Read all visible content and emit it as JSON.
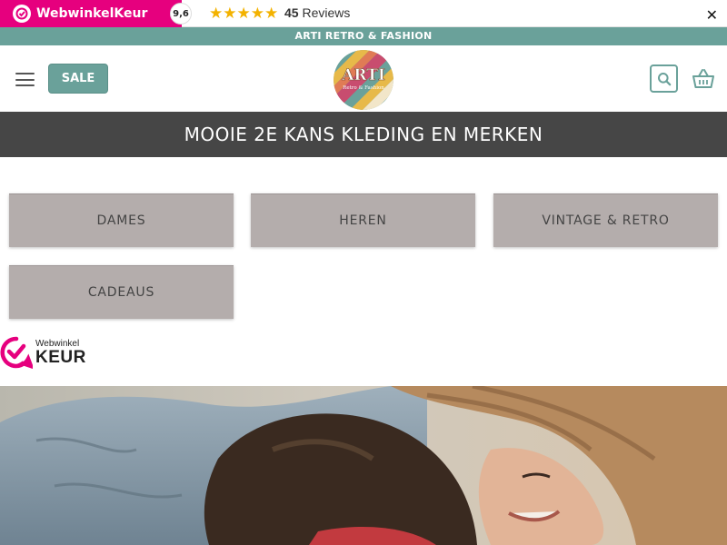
{
  "review_bar": {
    "brand": "WebwinkelKeur",
    "score": "9,6",
    "stars": "★★★★★",
    "review_count": "45",
    "reviews_label": "Reviews",
    "close": "✕"
  },
  "topbar": {
    "text": "ARTI RETRO & FASHION"
  },
  "header": {
    "sale_label": "SALE",
    "logo_text": "ARTI",
    "logo_subtext": "Retro & Fashion"
  },
  "title": "MOOIE 2E KANS KLEDING EN MERKEN",
  "categories": [
    {
      "label": "DAMES"
    },
    {
      "label": "HEREN"
    },
    {
      "label": "VINTAGE & RETRO"
    },
    {
      "label": "CADEAUS"
    }
  ],
  "webwinkelkeur_mark": {
    "line1": "Webwinkel",
    "line2": "KEUR"
  },
  "colors": {
    "accent": "#6aa19a",
    "brand_pink": "#e6007e",
    "title_band": "#464646",
    "category_bg": "#b4adac",
    "star": "#f3b200"
  }
}
